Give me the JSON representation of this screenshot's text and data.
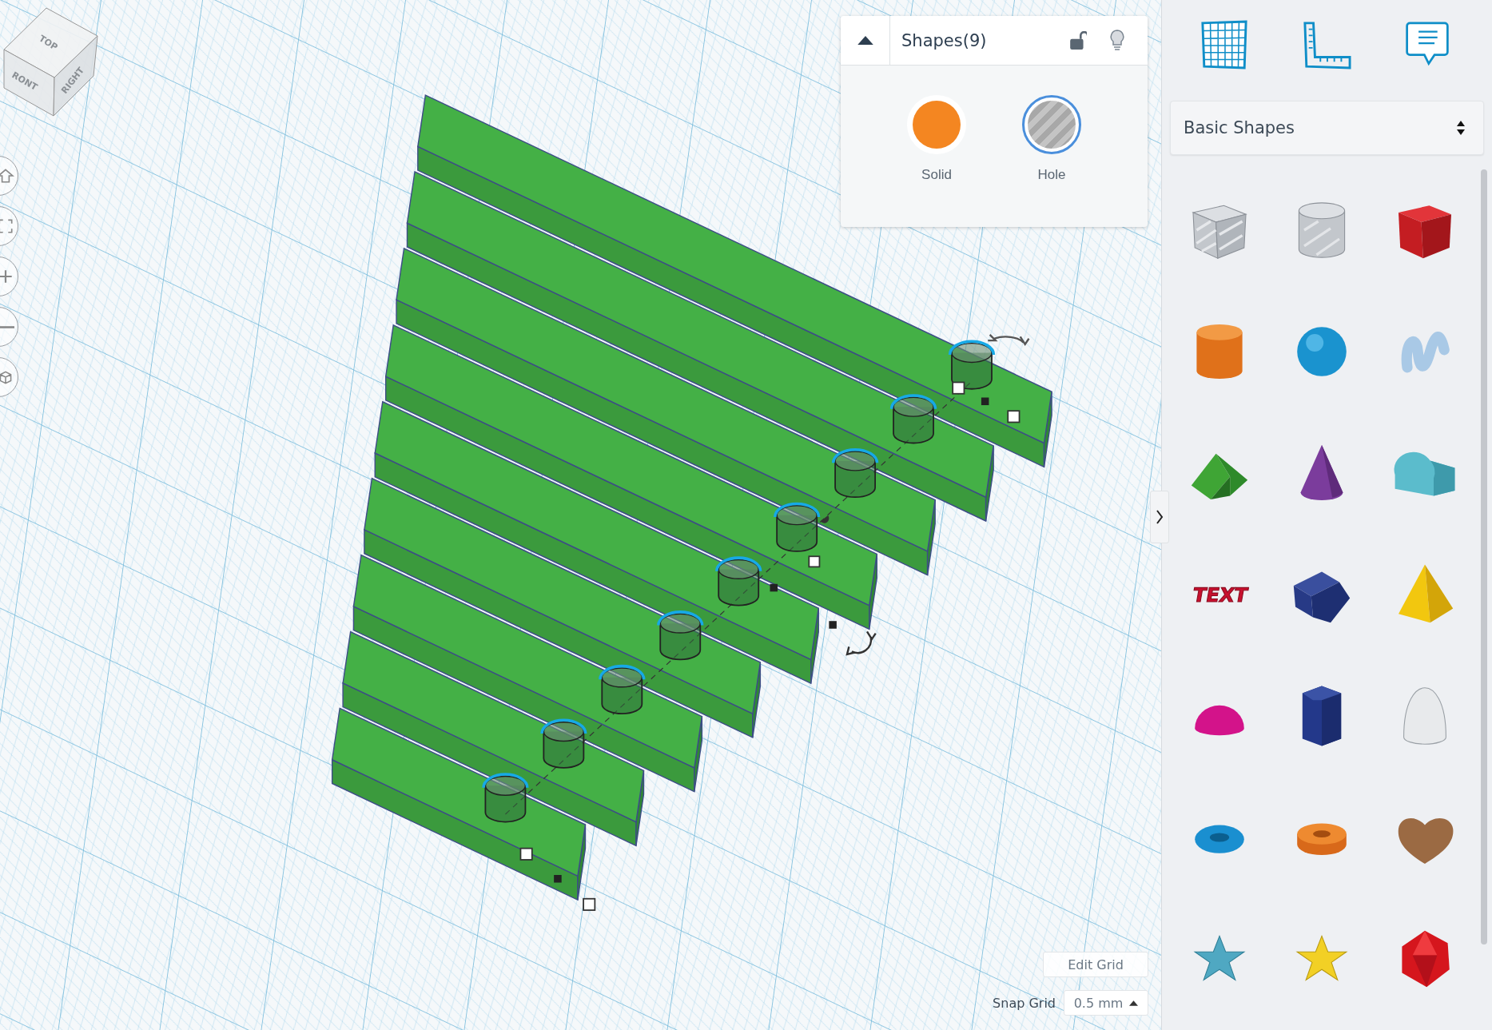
{
  "view_cube": {
    "faces": [
      "TOP",
      "RONT",
      "RIGHT"
    ]
  },
  "shapes_panel": {
    "title": "Shapes(9)",
    "options": [
      {
        "label": "Solid",
        "kind": "solid",
        "selected": false
      },
      {
        "label": "Hole",
        "kind": "hole",
        "selected": true
      }
    ]
  },
  "grid_controls": {
    "edit_button": "Edit Grid",
    "snap_label": "Snap Grid",
    "snap_value": "0.5 mm"
  },
  "library": {
    "category": "Basic Shapes",
    "shapes": [
      {
        "kind": "box-hole"
      },
      {
        "kind": "cylinder-hole"
      },
      {
        "kind": "box"
      },
      {
        "kind": "cylinder"
      },
      {
        "kind": "sphere"
      },
      {
        "kind": "scribble"
      },
      {
        "kind": "roof"
      },
      {
        "kind": "cone"
      },
      {
        "kind": "round-roof"
      },
      {
        "kind": "text",
        "label": "TEXT"
      },
      {
        "kind": "wedge"
      },
      {
        "kind": "pyramid"
      },
      {
        "kind": "half-sphere"
      },
      {
        "kind": "polygon"
      },
      {
        "kind": "paraboloid"
      },
      {
        "kind": "torus"
      },
      {
        "kind": "tube"
      },
      {
        "kind": "heart"
      },
      {
        "kind": "star"
      },
      {
        "kind": "star-yellow"
      },
      {
        "kind": "icosahedron"
      }
    ]
  }
}
